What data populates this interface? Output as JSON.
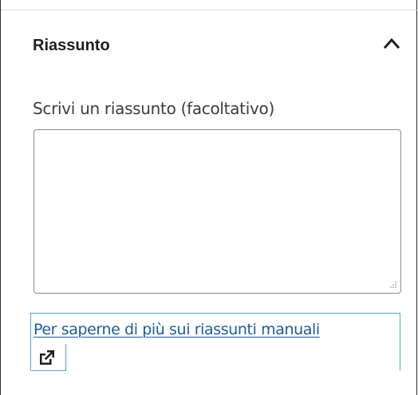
{
  "panel": {
    "title": "Riassunto",
    "toggle_icon": "chevron-up-icon",
    "expanded": true
  },
  "excerpt": {
    "label": "Scrivi un riassunto (facoltativo)",
    "value": "",
    "placeholder": ""
  },
  "help_link": {
    "text": "Per saperne di più sui riassunti manuali",
    "icon": "external-link-icon"
  },
  "colors": {
    "link": "#1a5c9c",
    "focus_outline": "#5aa0e0",
    "border": "#8c8c8c",
    "text": "#1e1e1e"
  }
}
